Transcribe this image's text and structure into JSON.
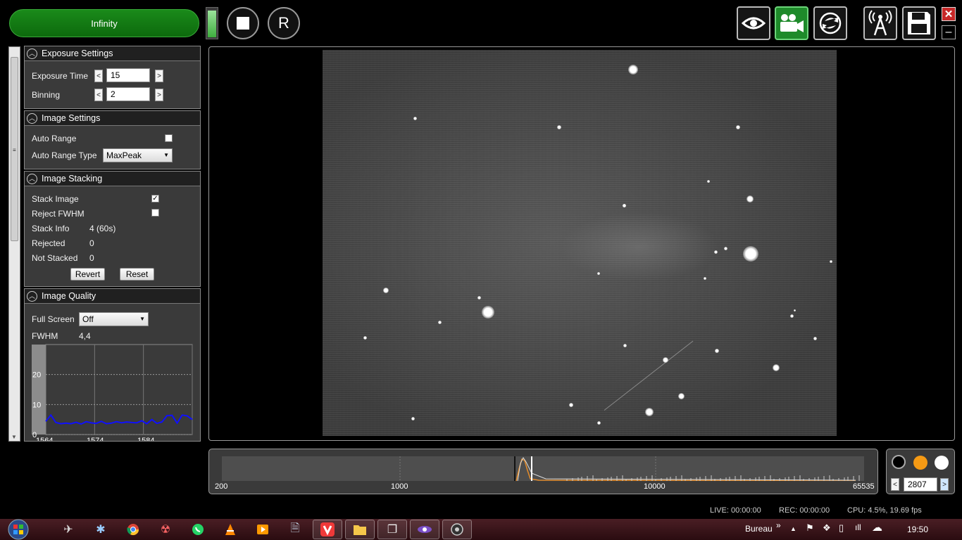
{
  "toolbar": {
    "infinity_label": "Infinity",
    "record_label": "R",
    "level_percent": 90
  },
  "panels": {
    "exposure": {
      "title": "Exposure Settings",
      "exposure_time_label": "Exposure Time",
      "exposure_time_value": "15",
      "binning_label": "Binning",
      "binning_value": "2",
      "dec": "<",
      "inc": ">"
    },
    "image_settings": {
      "title": "Image Settings",
      "auto_range_label": "Auto Range",
      "auto_range_checked": false,
      "auto_range_type_label": "Auto Range Type",
      "auto_range_type_value": "MaxPeak"
    },
    "stacking": {
      "title": "Image Stacking",
      "stack_image_label": "Stack Image",
      "stack_image_checked": true,
      "reject_fwhm_label": "Reject FWHM",
      "reject_fwhm_checked": false,
      "stack_info_label": "Stack Info",
      "stack_info_value": "4 (60s)",
      "rejected_label": "Rejected",
      "rejected_value": "0",
      "not_stacked_label": "Not Stacked",
      "not_stacked_value": "0",
      "revert_label": "Revert",
      "reset_label": "Reset"
    },
    "quality": {
      "title": "Image Quality",
      "full_screen_label": "Full Screen",
      "full_screen_value": "Off",
      "fwhm_label": "FWHM",
      "fwhm_value": "4,4"
    }
  },
  "chart_data": {
    "type": "line",
    "ylim": [
      0,
      30
    ],
    "y_ticks": [
      "20",
      "10",
      "0"
    ],
    "x_ticks": [
      "1564",
      "1574",
      "1584"
    ],
    "series": [
      {
        "values": [
          4.4,
          6.5,
          4.0,
          3.6,
          3.8,
          3.6,
          4.1,
          3.5,
          4.3,
          3.9,
          3.7,
          4.4,
          3.6,
          3.8,
          4.3,
          3.9,
          4.2,
          4.0,
          3.9,
          4.6,
          3.6,
          5.0,
          3.7,
          4.2,
          6.3,
          6.4,
          3.8,
          6.5,
          6.2,
          5.0
        ]
      }
    ],
    "color": "#1010ff"
  },
  "histogram": {
    "labels": [
      "200",
      "1000",
      "10000",
      "65535"
    ]
  },
  "range": {
    "value": "2807",
    "dec": "<",
    "inc": ">"
  },
  "status": {
    "live": "LIVE: 00:00:00",
    "rec": "REC: 00:00:00",
    "cpu": "CPU: 4.5%, 19.69 fps"
  },
  "taskbar": {
    "toolbar_label": "Bureau",
    "clock": "19:50",
    "overflow": "»"
  }
}
